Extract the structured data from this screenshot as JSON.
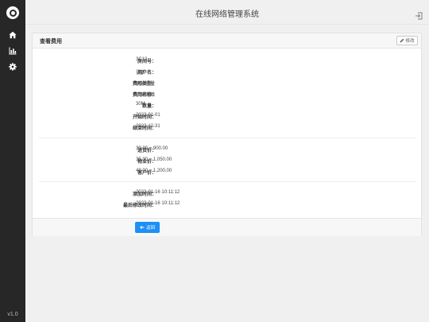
{
  "app": {
    "title": "在线网络管理系统",
    "version": "v1.0"
  },
  "sidebar": {
    "items": [
      {
        "name": "home",
        "icon": "home-icon"
      },
      {
        "name": "stats",
        "icon": "bar-chart-icon"
      },
      {
        "name": "settings",
        "icon": "gear-icon"
      }
    ]
  },
  "card": {
    "title": "查看费用",
    "edit_label": "修改"
  },
  "details": {
    "room_no": {
      "label": "房间号：",
      "value": "3C12"
    },
    "user_name": {
      "label": "用户名：",
      "value": "张名"
    },
    "fee_type": {
      "label": "费用类型：",
      "value": "网络流量"
    },
    "fee_name": {
      "label": "费用名称：",
      "value": "中国网络"
    },
    "quantity": {
      "label": "数量：",
      "value": "30M"
    },
    "start_time": {
      "label": "开始时间：",
      "value": "2023-01-01"
    },
    "end_time": {
      "label": "结束时间：",
      "value": "2023-12-31"
    }
  },
  "prices": {
    "cost_price": {
      "label": "进货价：",
      "value": "30.00 = 900.00"
    },
    "property_price": {
      "label": "物业价：",
      "value": "35.00 = 1,050.00"
    },
    "customer_price": {
      "label": "客户价：",
      "value": "40.00 = 1,200.00"
    }
  },
  "times": {
    "added": {
      "label": "添加时间：",
      "value": "2023-01-16 10:11:12"
    },
    "modified": {
      "label": "最后修改时间：",
      "value": "2023-01-16 10:11:12"
    }
  },
  "footer": {
    "back_label": "返回"
  },
  "colors": {
    "sidebar": "#272727",
    "primary": "#1e8ff5"
  }
}
